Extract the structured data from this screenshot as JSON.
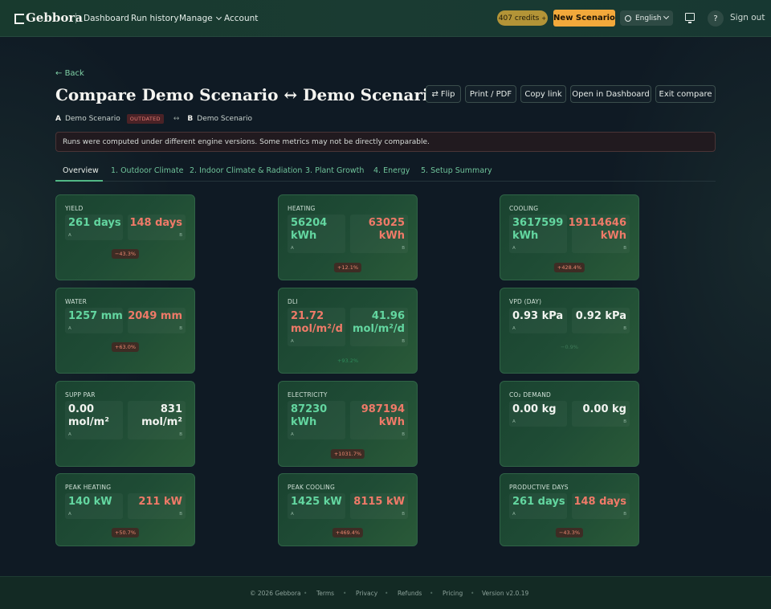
{
  "header": {
    "logo": "Gebbora",
    "nav": [
      {
        "label": "Dashboard"
      },
      {
        "label": "Run history"
      },
      {
        "label": "Manage"
      },
      {
        "label": "Account"
      }
    ],
    "credits": "407 credits",
    "new_scenario": "New Scenario",
    "language": "English",
    "help": "?",
    "signout": "Sign out"
  },
  "page": {
    "back": "Back",
    "title": "Compare Demo Scenario ↔ Demo Scenario",
    "actions": [
      "Flip",
      "Print / PDF",
      "Copy link",
      "Open in Dashboard",
      "Exit compare"
    ],
    "a_letter": "A",
    "a_name": "Demo Scenario",
    "a_badge": "OUTDATED",
    "swap": "↔",
    "b_letter": "B",
    "b_name": "Demo Scenario",
    "warning": "Runs were computed under different engine versions. Some metrics may not be directly comparable."
  },
  "tabs": [
    {
      "label": "Overview"
    },
    {
      "label": "1. Outdoor Climate"
    },
    {
      "label": "2. Indoor Climate & Radiation"
    },
    {
      "label": "3. Plant Growth"
    },
    {
      "label": "4. Energy"
    },
    {
      "label": "5. Setup Summary"
    }
  ],
  "cards": [
    {
      "label": "YIELD",
      "a": "261 days",
      "b": "148 days",
      "delta": "−43.3%"
    },
    {
      "label": "HEATING",
      "a": "56204 kWh",
      "b": "63025 kWh",
      "delta": "+12.1%"
    },
    {
      "label": "COOLING",
      "a": "3617599 kWh",
      "b": "19114646 kWh",
      "delta": "+428.4%"
    },
    {
      "label": "WATER",
      "a": "1257 mm",
      "b": "2049 mm",
      "delta": "+63.0%"
    },
    {
      "label": "DLI",
      "a": "21.72 mol/m²/d",
      "b": "41.96 mol/m²/d",
      "delta": "+93.2%"
    },
    {
      "label": "VPD (DAY)",
      "a": "0.93 kPa",
      "b": "0.92 kPa",
      "delta": "−0.9%"
    },
    {
      "label": "SUPP PAR",
      "a": "0.00 mol/m²",
      "b": "831 mol/m²",
      "delta": ""
    },
    {
      "label": "ELECTRICITY",
      "a": "87230 kWh",
      "b": "987194 kWh",
      "delta": "+1031.7%"
    },
    {
      "label": "CO₂ DEMAND",
      "a": "0.00 kg",
      "b": "0.00 kg",
      "delta": ""
    },
    {
      "label": "PEAK HEATING",
      "a": "140 kW",
      "b": "211 kW",
      "delta": "+50.7%"
    },
    {
      "label": "PEAK COOLING",
      "a": "1425 kW",
      "b": "8115 kW",
      "delta": "+469.4%"
    },
    {
      "label": "PRODUCTIVE DAYS",
      "a": "261 days",
      "b": "148 days",
      "delta": "−43.3%"
    }
  ],
  "value_tags": {
    "a": "A",
    "b": "B"
  },
  "footer": {
    "copyright": "© 2026 Gebbora",
    "links": [
      "Terms",
      "Privacy",
      "Refunds",
      "Pricing"
    ],
    "version": "Version v2.0.19"
  },
  "colors": {
    "accent_green": "#63d6a0",
    "accent_red": "#ef7a68",
    "primary_button": "#f2a93b",
    "credits_badge": "#b39437"
  }
}
